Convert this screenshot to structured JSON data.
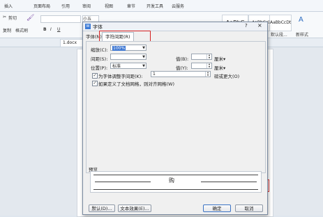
{
  "app": {
    "ribbon_tabs": [
      "插入",
      "页面布局",
      "引用",
      "审阅",
      "视图",
      "章节",
      "开发工具",
      "云服务"
    ],
    "ribbon": {
      "cut": "剪切",
      "copy": "复制",
      "format_painter": "格式刷",
      "font_size": "小五",
      "style_1": "AaBbC",
      "style_2": "AaBbCcD",
      "style_3": "AaBbCcDt",
      "default_paragraph_font": "默认段...",
      "new_style": "新样式"
    },
    "doc_tab": "1.docx"
  },
  "dialog": {
    "title": "字体",
    "help": "?",
    "close": "×",
    "tabs": {
      "font": "字体(N)",
      "spacing": "字符间距(R)"
    },
    "scale": {
      "label": "缩放(C):",
      "value": "100%"
    },
    "spacing": {
      "label": "间距(S):",
      "value": "",
      "amount_label": "值(B):",
      "unit": "厘米▾"
    },
    "position": {
      "label": "位置(P):",
      "value": "标准",
      "amount_label": "值(Y):",
      "unit": "厘米▾"
    },
    "kerning": {
      "label": "为字体调整字间距(K):",
      "value": "1",
      "suffix": "磅或更大(O)",
      "checked": true
    },
    "snap_grid": {
      "label": "如果定义了文档网格，则对齐网格(W)",
      "checked": true
    },
    "preview": {
      "label": "预览",
      "text": "购"
    },
    "buttons": {
      "default": "默认(D)...",
      "text_effects": "文本效果(E)...",
      "ok": "确定",
      "cancel": "取消"
    }
  }
}
